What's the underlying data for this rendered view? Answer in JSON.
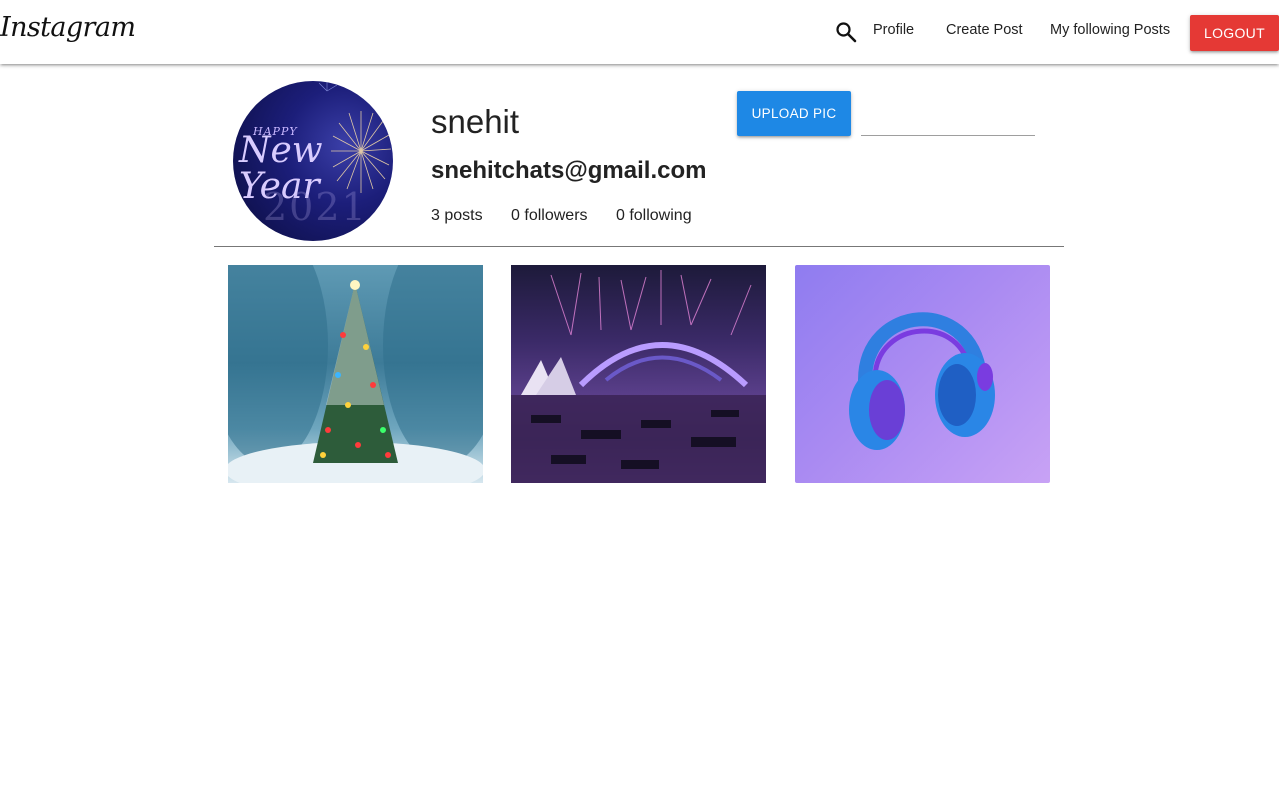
{
  "navbar": {
    "brand": "Instagram",
    "search_icon": "search-icon",
    "links": {
      "profile": "Profile",
      "create_post": "Create Post",
      "following_posts": "My following Posts"
    },
    "logout_label": "LOGOUT"
  },
  "profile": {
    "avatar_text": {
      "line1": "HAPPY",
      "line2": "New Year",
      "line3": "2021"
    },
    "username": "snehit",
    "email": "snehitchats@gmail.com",
    "stats": {
      "posts": "3 posts",
      "followers": "0 followers",
      "following": "0 following"
    },
    "upload_label": "UPLOAD PIC",
    "file_path_value": ""
  },
  "gallery": [
    {
      "subject": "snowy christmas tree"
    },
    {
      "subject": "harbour fireworks at night"
    },
    {
      "subject": "blue headphones on purple"
    }
  ],
  "colors": {
    "logout": "#e53935",
    "upload": "#1e88e5",
    "divider": "#777777"
  }
}
